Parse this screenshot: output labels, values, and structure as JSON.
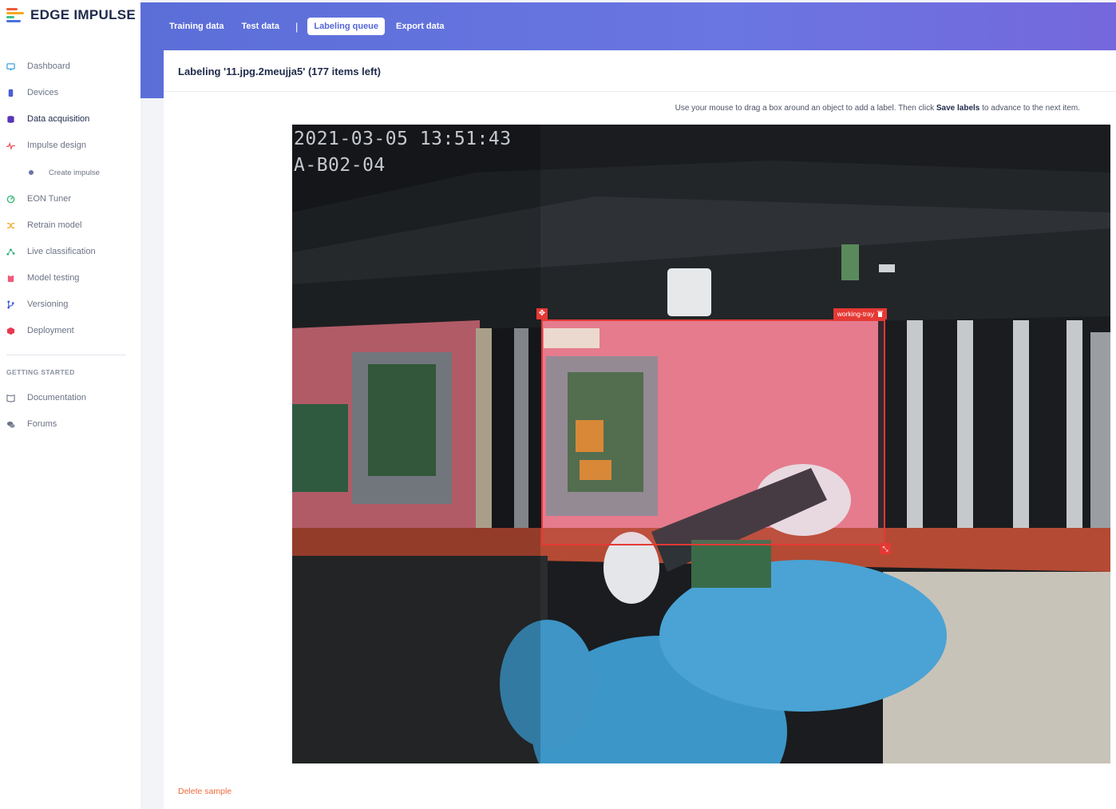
{
  "brand": {
    "name": "EDGE IMPULSE"
  },
  "sidebar": {
    "items": [
      {
        "label": "Dashboard",
        "icon": "monitor-icon",
        "color": "#3fa3e0"
      },
      {
        "label": "Devices",
        "icon": "device-icon",
        "color": "#4a5fd0"
      },
      {
        "label": "Data acquisition",
        "icon": "database-icon",
        "color": "#5a35b8",
        "active": true
      },
      {
        "label": "Impulse design",
        "icon": "pulse-icon",
        "color": "#f0535f"
      },
      {
        "label": "Create impulse",
        "icon": "dot-icon",
        "color": "#6a76a8",
        "sub": true
      },
      {
        "label": "EON Tuner",
        "icon": "tuner-icon",
        "color": "#2bb673"
      },
      {
        "label": "Retrain model",
        "icon": "shuffle-icon",
        "color": "#f0a81c"
      },
      {
        "label": "Live classification",
        "icon": "graph-icon",
        "color": "#27b07a"
      },
      {
        "label": "Model testing",
        "icon": "clipboard-icon",
        "color": "#ef5b7b"
      },
      {
        "label": "Versioning",
        "icon": "branch-icon",
        "color": "#3f58d8"
      },
      {
        "label": "Deployment",
        "icon": "cube-icon",
        "color": "#e8384f"
      }
    ],
    "section_title": "GETTING STARTED",
    "links": [
      {
        "label": "Documentation",
        "icon": "book-icon"
      },
      {
        "label": "Forums",
        "icon": "chat-icon"
      }
    ]
  },
  "tabs": {
    "items": [
      "Training data",
      "Test data",
      "Labeling queue",
      "Export data"
    ],
    "active": "Labeling queue",
    "separator": "|"
  },
  "labeling": {
    "title": "Labeling '11.jpg.2meujja5' (177 items left)",
    "hint_pre": "Use your mouse to drag a box around an object to add a label. Then click ",
    "hint_bold": "Save labels",
    "hint_post": " to advance to the next item.",
    "image": {
      "timestamp": "2021-03-05 13:51:43",
      "camera_id": "A-B02-04"
    },
    "box": {
      "label": "working-tray"
    },
    "delete_label": "Delete sample"
  },
  "colors": {
    "header_gradient_start": "#5b6ed8",
    "header_gradient_end": "#7468dc",
    "accent": "#5567d8",
    "bbox": "#e53935",
    "danger_link": "#ef6a3a"
  }
}
